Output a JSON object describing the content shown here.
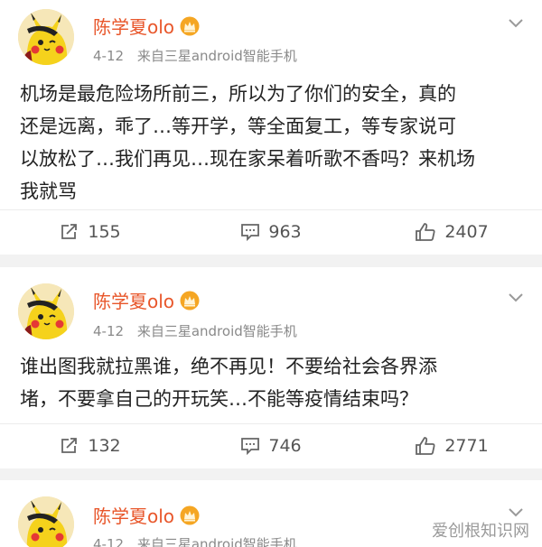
{
  "posts": [
    {
      "user": {
        "name": "陈学夏olo",
        "badge": "crown-icon"
      },
      "date": "4-12",
      "source": "来自三星android智能手机",
      "content_lines": [
        "机场是最危险场所前三，所以为了你们的安全，真的",
        "还是远离，乖了…等开学，等全面复工，等专家说可",
        "以放松了…我们再见…现在家呆着听歌不香吗？来机场",
        "我就骂"
      ],
      "reposts": "155",
      "comments": "963",
      "likes": "2407"
    },
    {
      "user": {
        "name": "陈学夏olo",
        "badge": "crown-icon"
      },
      "date": "4-12",
      "source": "来自三星android智能手机",
      "content_lines": [
        "谁出图我就拉黑谁，绝不再见！不要给社会各界添",
        "堵，不要拿自己的开玩笑…不能等疫情结束吗？"
      ],
      "reposts": "132",
      "comments": "746",
      "likes": "2771"
    },
    {
      "user": {
        "name": "陈学夏olo",
        "badge": "crown-icon"
      },
      "date": "4-12",
      "source": "来自三星android智能手机"
    }
  ],
  "watermark": "爱创根知识网",
  "colors": {
    "username": "#e8562a",
    "meta": "#8a8a8a",
    "text": "#222222",
    "background": "#f2f2f2"
  }
}
